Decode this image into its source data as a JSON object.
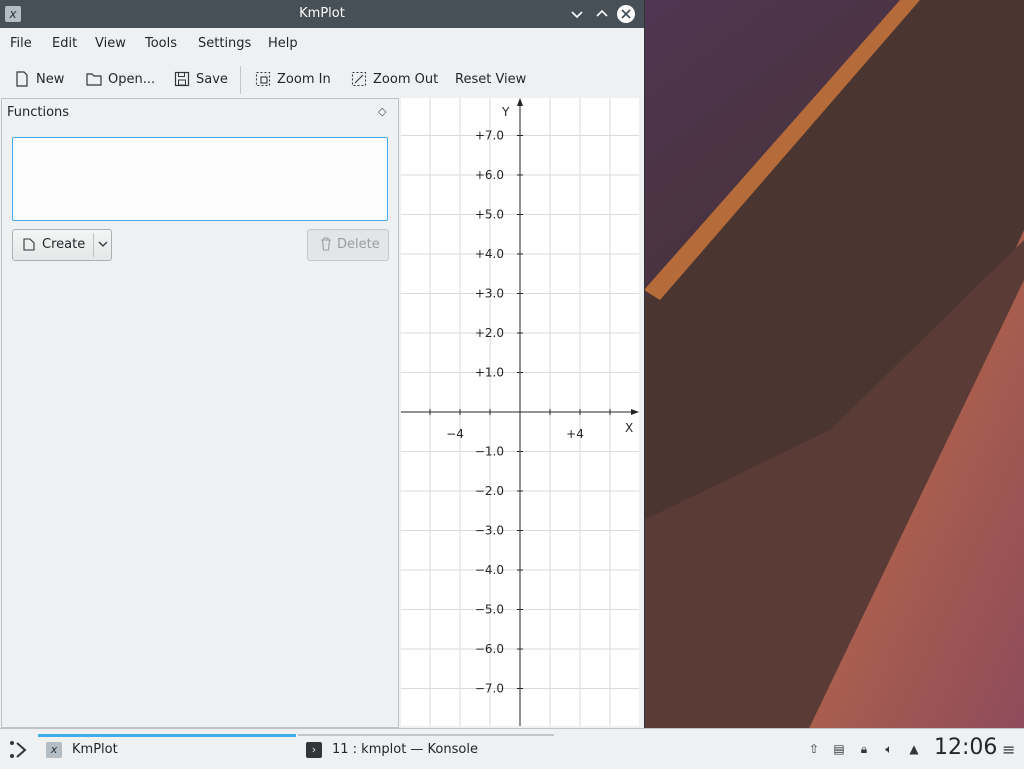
{
  "window": {
    "title": "KmPlot",
    "icon": "kmplot-icon",
    "controls": {
      "minimize": "chevron-down-icon",
      "maximize": "chevron-up-icon",
      "close": "close-icon"
    }
  },
  "menubar": {
    "items": [
      "File",
      "Edit",
      "View",
      "Tools",
      "Settings",
      "Help"
    ]
  },
  "toolbar": {
    "new_label": "New",
    "open_label": "Open...",
    "save_label": "Save",
    "zoom_in_label": "Zoom In",
    "zoom_out_label": "Zoom Out",
    "reset_view_label": "Reset View"
  },
  "functions_panel": {
    "title": "Functions",
    "create_label": "Create",
    "delete_label": "Delete",
    "function_list": []
  },
  "plot": {
    "x_axis_label": "X",
    "y_axis_label": "Y",
    "x_tick_labels": [
      "−4",
      "+4"
    ],
    "y_tick_labels": [
      "+7.0",
      "+6.0",
      "+5.0",
      "+4.0",
      "+3.0",
      "+2.0",
      "+1.0",
      "−1.0",
      "−2.0",
      "−3.0",
      "−4.0",
      "−5.0",
      "−6.0",
      "−7.0"
    ],
    "accent_axis_color": "#232629",
    "grid_color": "#d9dadb"
  },
  "taskbar": {
    "tasks": [
      {
        "label": "KmPlot",
        "active": true
      },
      {
        "label": "11 : kmplot — Konsole",
        "active": false
      }
    ],
    "clock": "12:06",
    "accent_color": "#3daee9"
  }
}
